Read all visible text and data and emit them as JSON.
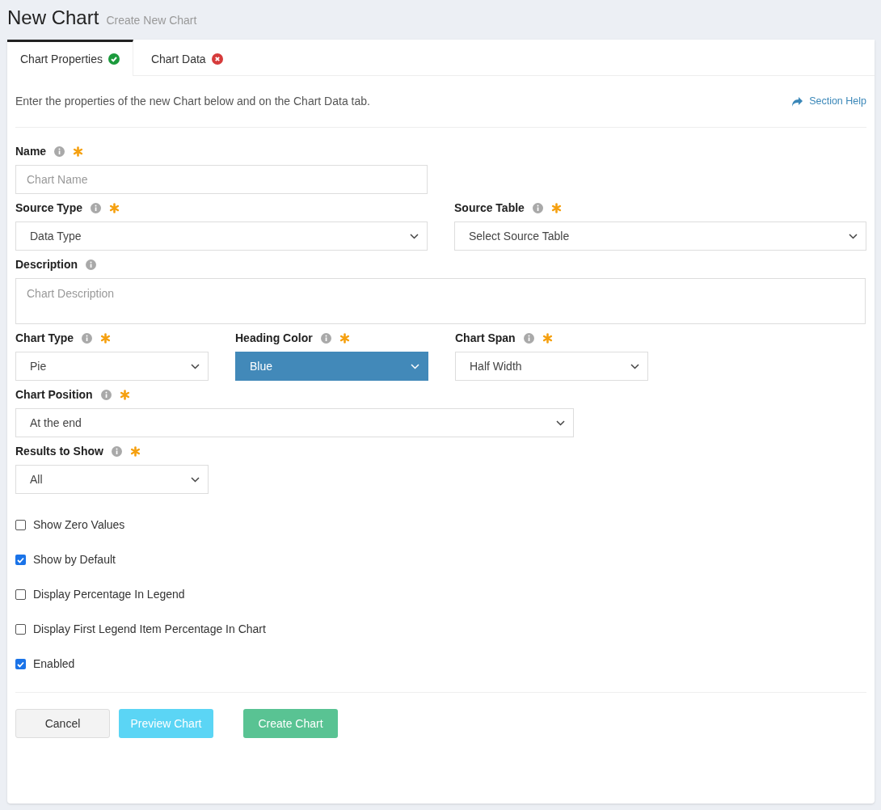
{
  "header": {
    "title": "New Chart",
    "subtitle": "Create New Chart"
  },
  "tabs": [
    {
      "label": "Chart Properties",
      "selected": true,
      "complete": true
    },
    {
      "label": "Chart Data",
      "selected": false,
      "complete": false
    }
  ],
  "intro": "Enter the properties of the new Chart below and on the Chart Data tab.",
  "help_link": "Section Help",
  "field_rows": [
    [
      {
        "kind": "text",
        "label": "Name",
        "required": true,
        "placeholder": "Chart Name"
      }
    ],
    [
      {
        "kind": "select",
        "label": "Source Type",
        "required": true,
        "value": "Data Type"
      },
      {
        "kind": "select",
        "label": "Source Table",
        "required": true,
        "value": "Select Source Table"
      }
    ],
    [
      {
        "kind": "textarea",
        "label": "Description",
        "required": false,
        "placeholder": "Chart Description"
      }
    ],
    [
      {
        "kind": "select",
        "label": "Chart Type",
        "required": true,
        "value": "Pie"
      },
      {
        "kind": "select",
        "label": "Heading Color",
        "required": true,
        "value": "Blue",
        "color": "#4289b9"
      },
      {
        "kind": "select",
        "label": "Chart Span",
        "required": true,
        "value": "Half Width"
      }
    ],
    [
      {
        "kind": "select",
        "label": "Chart Position",
        "required": true,
        "value": "At the end"
      }
    ],
    [
      {
        "kind": "select",
        "label": "Results to Show",
        "required": true,
        "value": "All"
      }
    ]
  ],
  "checkboxes": [
    {
      "label": "Show Zero Values",
      "checked": false
    },
    {
      "label": "Show by Default",
      "checked": true
    },
    {
      "label": "Display Percentage In Legend",
      "checked": false
    },
    {
      "label": "Display First Legend Item Percentage In Chart",
      "checked": false
    },
    {
      "label": "Enabled",
      "checked": true
    }
  ],
  "buttons": [
    {
      "kind": "cancel",
      "label": "Cancel"
    },
    {
      "kind": "preview",
      "label": "Preview Chart"
    },
    {
      "kind": "create",
      "label": "Create Chart"
    }
  ]
}
